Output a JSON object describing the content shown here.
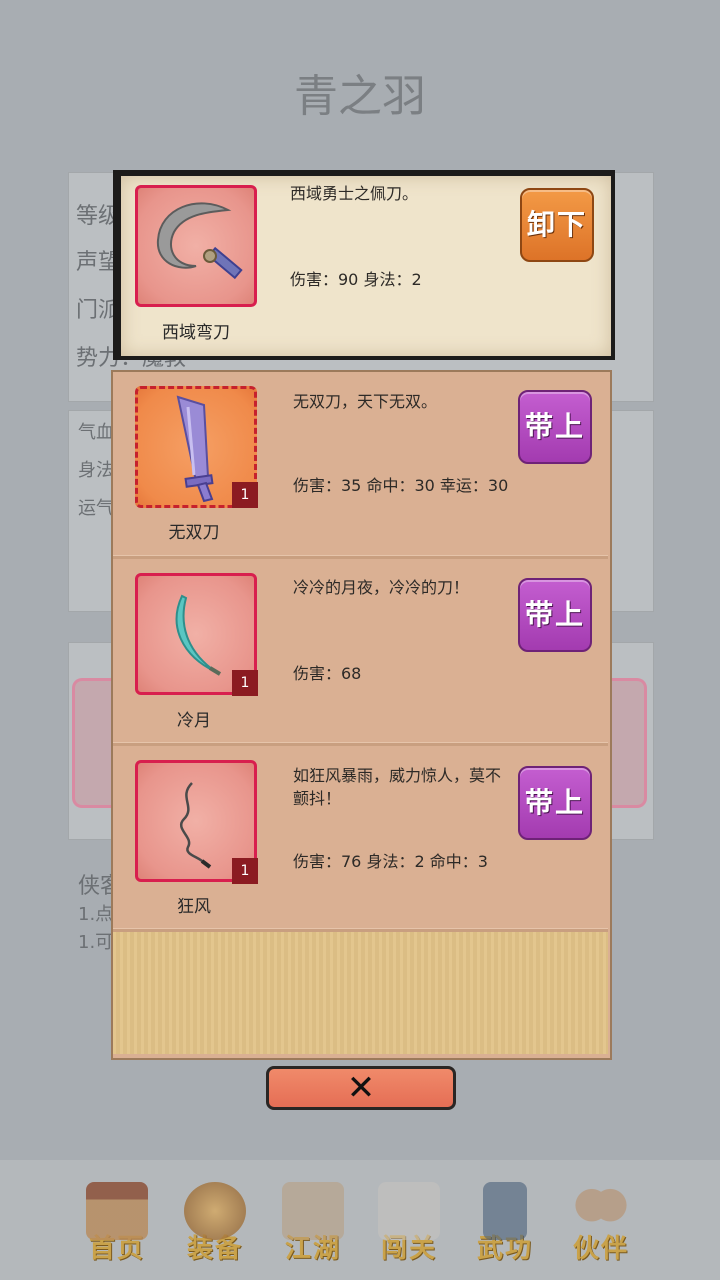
{
  "background": {
    "title": "青之羽",
    "info_lines": [
      "等级",
      "声望",
      "门派",
      "势力：魔教"
    ],
    "attr_lines": [
      "气血",
      "身法",
      "运气"
    ],
    "tips_lines": [
      "侠客",
      "1.点",
      "1.可"
    ]
  },
  "equipped": {
    "name": "西域弯刀",
    "desc": "西域勇士之佩刀。",
    "stats": "伤害：90 身法：2",
    "button": "卸下",
    "icon": "scimitar-icon"
  },
  "items": [
    {
      "name": "无双刀",
      "desc": "无双刀，天下无双。",
      "stats": "伤害：35 命中：30 幸运：30",
      "count": "1",
      "button": "带上",
      "icon": "broadsword-icon"
    },
    {
      "name": "冷月",
      "desc": "冷冷的月夜，冷冷的刀！",
      "stats": "伤害：68",
      "count": "1",
      "button": "带上",
      "icon": "crescent-blade-icon"
    },
    {
      "name": "狂风",
      "desc": "如狂风暴雨，威力惊人，莫不颤抖！",
      "stats": "伤害：76 身法：2 命中：3",
      "count": "1",
      "button": "带上",
      "icon": "whip-blade-icon"
    }
  ],
  "close_label": "✕",
  "nav": [
    {
      "label": "首页",
      "icon": "house-icon"
    },
    {
      "label": "装备",
      "icon": "armor-icon"
    },
    {
      "label": "江湖",
      "icon": "scroll-map-icon"
    },
    {
      "label": "闯关",
      "icon": "crossed-swords-icon"
    },
    {
      "label": "武功",
      "icon": "book-icon"
    },
    {
      "label": "伙伴",
      "icon": "companions-icon"
    }
  ]
}
